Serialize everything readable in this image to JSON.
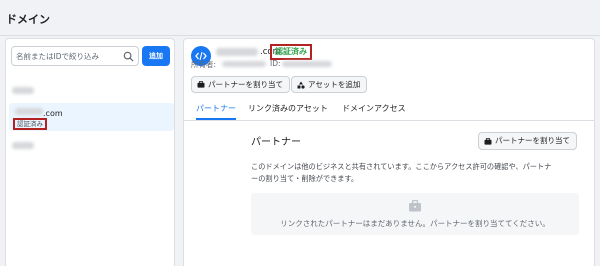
{
  "header": {
    "title": "ドメイン"
  },
  "left": {
    "search_placeholder": "名前またはIDで絞り込み",
    "add_label": "追加",
    "selected_domain": ".com",
    "selected_badge": "認証済み"
  },
  "detail": {
    "domain_suffix": ".com",
    "verified_label": "認証済み",
    "owner_label": "所有者:",
    "id_label": "ID:",
    "assign_partner_label": "パートナーを割り当て",
    "add_asset_label": "アセットを追加",
    "tabs": [
      "パートナー",
      "リンク済みのアセット",
      "ドメインアクセス"
    ],
    "partner_section": {
      "title": "パートナー",
      "assign_button_label": "パートナーを割り当て",
      "description_line1": "このドメインは他のビジネスと共有されています。ここからアクセス許可の確認や、パートナ",
      "description_line2": "ーの割り当て・削除ができます。",
      "empty_text": "リンクされたパートナーはまだありません。パートナーを割り当ててください。"
    }
  },
  "colors": {
    "accent": "#1877f2",
    "verified": "#31a24c",
    "highlight_border": "#b32121"
  }
}
